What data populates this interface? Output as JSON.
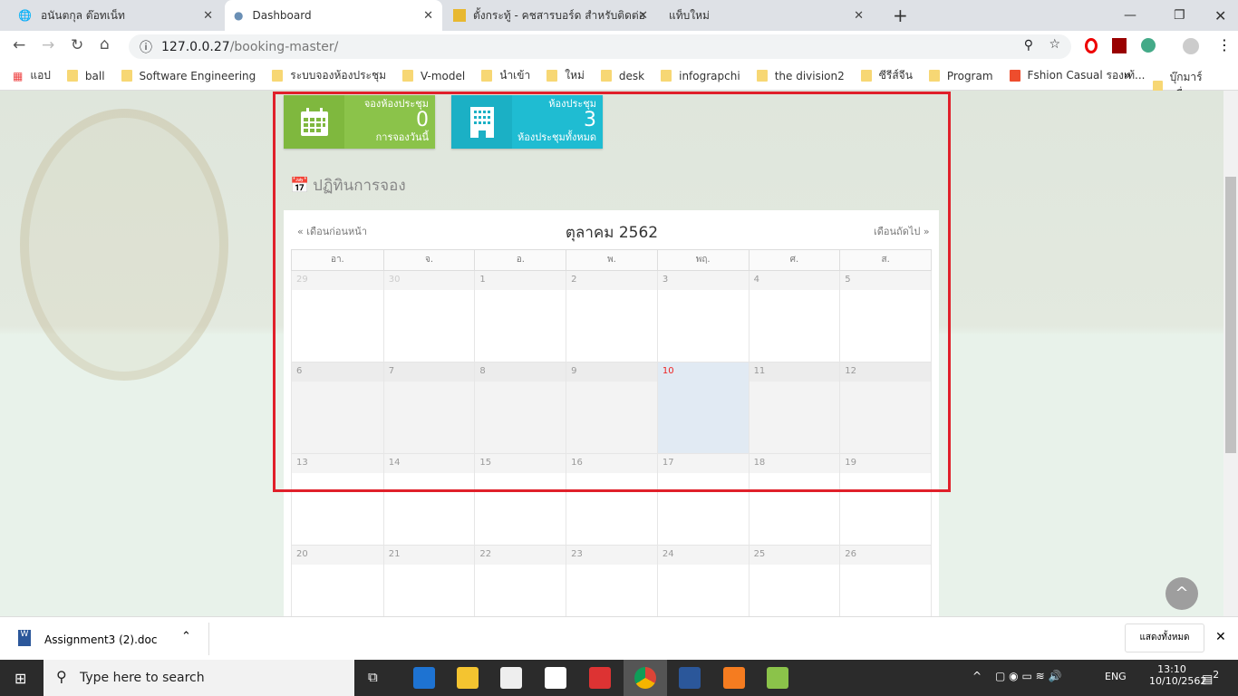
{
  "browser": {
    "tabs": [
      {
        "title": "อนันตกุล ต๊อทเน็ท"
      },
      {
        "title": "Dashboard"
      },
      {
        "title": "ตั้งกระทู้ - คชสารบอร์ด สำหรับติดต่อส"
      },
      {
        "title": "แท็บใหม่"
      }
    ],
    "url_host": "127.0.0.27",
    "url_path": "/booking-master/",
    "bookmarks": [
      "แอป",
      "ball",
      "Software Engineering",
      "ระบบจองห้องประชุม",
      "V-model",
      "นำเข้า",
      "ใหม่",
      "desk",
      "infograpchi",
      "the division2",
      "ซีรีส์จีน",
      "Program",
      "Fshion Casual รองเท้..."
    ],
    "other_bookmarks": "บุ๊กมาร์กอื่นๆ"
  },
  "cards": [
    {
      "label": "จองห้องประชุม",
      "value": "0",
      "sub": "การจองวันนี้",
      "color": "#8bc34a",
      "icon": "calendar-icon"
    },
    {
      "label": "ห้องประชุม",
      "value": "3",
      "sub": "ห้องประชุมทั้งหมด",
      "color": "#1fbcd2",
      "icon": "building-icon"
    }
  ],
  "calendar": {
    "title": "ปฏิทินการจอง",
    "prev": "« เดือนก่อนหน้า",
    "next": "เดือนถัดไป »",
    "month": "ตุลาคม 2562",
    "weekdays": [
      "อา.",
      "จ.",
      "อ.",
      "พ.",
      "พฤ.",
      "ศ.",
      "ส."
    ],
    "weeks": [
      [
        "29",
        "30",
        "1",
        "2",
        "3",
        "4",
        "5"
      ],
      [
        "6",
        "7",
        "8",
        "9",
        "10",
        "11",
        "12"
      ],
      [
        "13",
        "14",
        "15",
        "16",
        "17",
        "18",
        "19"
      ],
      [
        "20",
        "21",
        "22",
        "23",
        "24",
        "25",
        "26"
      ]
    ],
    "today": "10"
  },
  "download": {
    "file": "Assignment3 (2).doc",
    "show_all": "แสดงทั้งหมด"
  },
  "taskbar": {
    "search": "Type here to search",
    "lang": "ENG",
    "time": "13:10",
    "date": "10/10/2562",
    "notifications": "2"
  }
}
